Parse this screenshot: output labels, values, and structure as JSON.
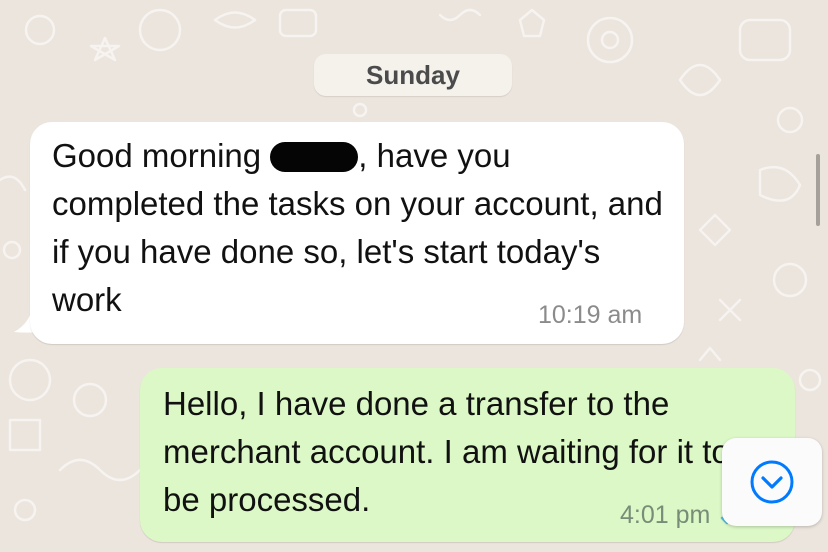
{
  "date_separator": {
    "label": "Sunday"
  },
  "messages": {
    "incoming": {
      "text_before_redaction": "Good morning ",
      "text_after_redaction": ", have you completed the tasks on your account, and if you have done so, let's start today's work",
      "time": "10:19 am",
      "bubble_color": "#ffffff"
    },
    "outgoing": {
      "text": "Hello, I have done a transfer to the merchant account. I am waiting for it to be processed.",
      "time": "4:01 pm",
      "bubble_color": "#dcf8c6",
      "read_ticks_color": "#53bdeb"
    }
  },
  "scroll_to_bottom": {
    "icon": "chevron-down-circle-icon",
    "accent": "#007aff"
  },
  "colors": {
    "wallpaper": "#ece5dd",
    "text": "#111111",
    "timestamp": "#8b8b8b"
  }
}
